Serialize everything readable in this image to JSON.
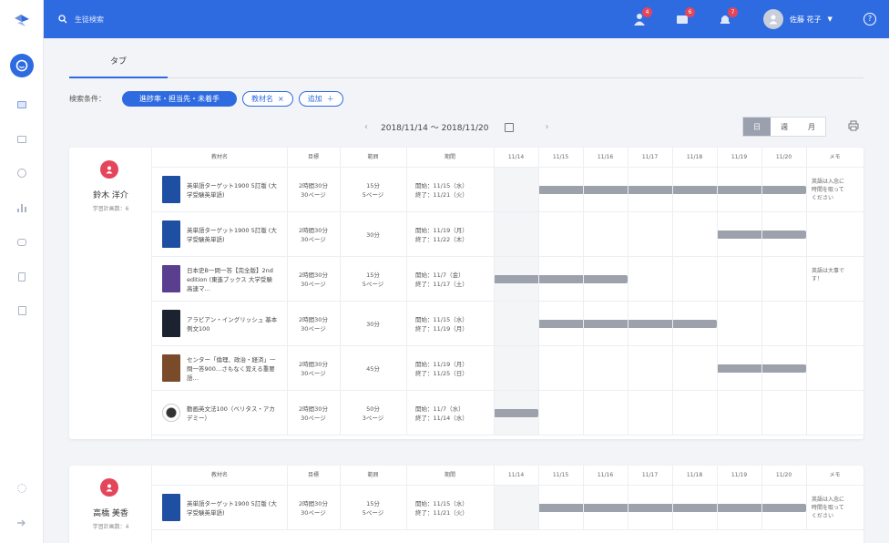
{
  "header": {
    "search_placeholder": "生徒検索",
    "badges": {
      "people": "4",
      "inbox": "6",
      "bell": "7"
    },
    "user_name": "佐藤 花子",
    "help": "?"
  },
  "sidebar": {
    "items": [
      "calendar-icon",
      "list-icon",
      "mail-icon",
      "clock-icon",
      "chart-icon",
      "chat-icon",
      "book-icon",
      "document-icon",
      "settings-icon",
      "logout-icon"
    ]
  },
  "tab": {
    "label": "タブ"
  },
  "filters": {
    "label": "検索条件：",
    "primary_chip": "進捗率・担当先・未着手",
    "chip2": "教材名",
    "chip3": "追加"
  },
  "date_range": "2018/11/14 〜 2018/11/20",
  "view_toggle": [
    "日",
    "週",
    "月"
  ],
  "table_headers": {
    "material": "教材名",
    "time": "目標",
    "amount": "範囲",
    "period": "期間",
    "days": [
      "11/14",
      "11/15",
      "11/16",
      "11/17",
      "11/18",
      "11/19",
      "11/20"
    ],
    "memo": "メモ"
  },
  "students": [
    {
      "name": "鈴木 洋介",
      "sub": "学習計画数：6",
      "rows": [
        {
          "title": "英単語ターゲット1900 5訂版 (大学受験英単語)",
          "time": "2時間30分\n30ページ",
          "amount": "15分\n5ページ",
          "period": "開始：11/15（水）\n終了：11/21（火）",
          "bar_start": 1,
          "bar_end": 7,
          "memo": "英語は入念に\n時間を取って\nください",
          "cover": "#1f4fa3"
        },
        {
          "title": "英単語ターゲット1900 5訂版 (大学受験英単語)",
          "time": "2時間30分\n30ページ",
          "amount": "30分",
          "period": "開始：11/19（月）\n終了：11/22（木）",
          "bar_start": 5,
          "bar_end": 7,
          "memo": "",
          "cover": "#1f4fa3"
        },
        {
          "title": "日本史B一問一答【完全版】2nd edition (東進ブックス 大学受験 高速マ…",
          "time": "2時間30分\n30ページ",
          "amount": "15分\n5ページ",
          "period": "開始：11/7（金）\n終了：11/17（土）",
          "bar_start": 0,
          "bar_end": 3,
          "memo": "英語は大事で\nす！",
          "cover": "#5a3f8f"
        },
        {
          "title": "アラビアン・イングリッシュ 基本例文100",
          "time": "2時間30分\n30ページ",
          "amount": "30分",
          "period": "開始：11/15（水）\n終了：11/19（月）",
          "bar_start": 1,
          "bar_end": 5,
          "memo": "",
          "cover": "#1c2230"
        },
        {
          "title": "センター「倫理、政治・経済」一問一答900…さもなく覚える重要語…",
          "time": "2時間30分\n30ページ",
          "amount": "45分",
          "period": "開始：11/19（月）\n終了：11/25（日）",
          "bar_start": 5,
          "bar_end": 7,
          "memo": "",
          "cover": "#7a4b2a"
        },
        {
          "title": "動画英文法100（ベリタス・アカデミー）",
          "time": "2時間30分\n30ページ",
          "amount": "50分\n3ページ",
          "period": "開始：11/7（水）\n終了：11/14（水）",
          "bar_start": 0,
          "bar_end": 1,
          "memo": "",
          "cover": "#ffffff"
        }
      ]
    },
    {
      "name": "高橋 美香",
      "sub": "学習計画数：4",
      "rows": [
        {
          "title": "英単語ターゲット1900 5訂版 (大学受験英単語)",
          "time": "2時間30分\n30ページ",
          "amount": "15分\n5ページ",
          "period": "開始：11/15（水）\n終了：11/21（火）",
          "bar_start": 1,
          "bar_end": 7,
          "memo": "英語は入念に\n時間を取って\nください",
          "cover": "#1f4fa3"
        }
      ]
    }
  ]
}
